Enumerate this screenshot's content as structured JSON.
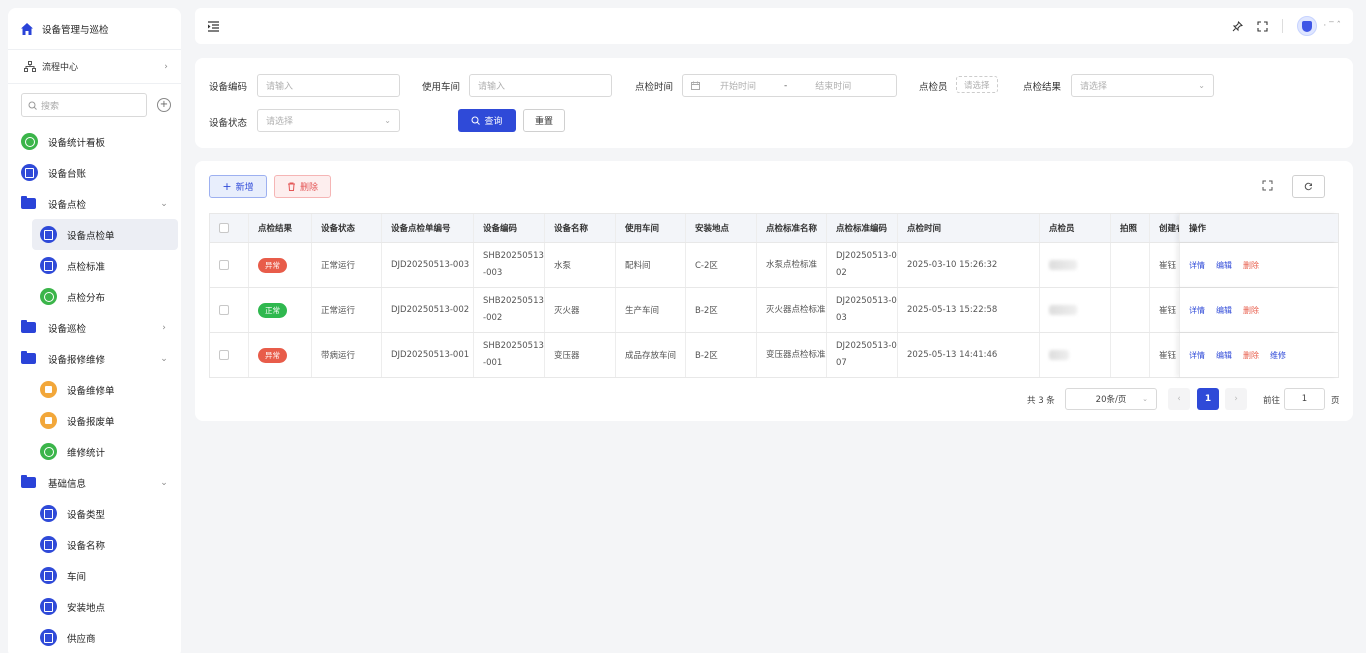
{
  "sidebar": {
    "title": "设备管理与巡检",
    "flow_center": "流程中心",
    "search_placeholder": "搜索",
    "items": [
      {
        "label": "设备统计看板"
      },
      {
        "label": "设备台账"
      },
      {
        "label": "设备点检"
      },
      {
        "label": "设备点检单"
      },
      {
        "label": "点检标准"
      },
      {
        "label": "点检分布"
      },
      {
        "label": "设备巡检"
      },
      {
        "label": "设备报修维修"
      },
      {
        "label": "设备维修单"
      },
      {
        "label": "设备报废单"
      },
      {
        "label": "维修统计"
      },
      {
        "label": "基础信息"
      },
      {
        "label": "设备类型"
      },
      {
        "label": "设备名称"
      },
      {
        "label": "车间"
      },
      {
        "label": "安装地点"
      },
      {
        "label": "供应商"
      }
    ]
  },
  "filters": {
    "device_code_label": "设备编码",
    "device_code_placeholder": "请输入",
    "workshop_label": "使用车间",
    "workshop_placeholder": "请输入",
    "time_label": "点检时间",
    "start_placeholder": "开始时间",
    "range_sep": "-",
    "end_placeholder": "结束时间",
    "inspector_label": "点检员",
    "inspector_placeholder": "请选择",
    "result_label": "点检结果",
    "result_placeholder": "请选择",
    "status_label": "设备状态",
    "status_placeholder": "请选择",
    "query_label": "查询",
    "reset_label": "重置"
  },
  "toolbar": {
    "add_label": "新增",
    "delete_label": "删除"
  },
  "table": {
    "headers": [
      "点检结果",
      "设备状态",
      "设备点检单编号",
      "设备编码",
      "设备名称",
      "使用车间",
      "安装地点",
      "点检标准名称",
      "点检标准编码",
      "点检时间",
      "点检员",
      "拍照",
      "创建者",
      "操作"
    ],
    "rows": [
      {
        "result": "异常",
        "result_color": "#e85c4a",
        "status": "正常运行",
        "no": "DJD20250513-003",
        "code": "SHB20250513-003",
        "name": "水泵",
        "workshop": "配料间",
        "location": "C-2区",
        "std_name": "水泵点检标准",
        "std_code": "DJ20250513-002",
        "time": "2025-03-10 15:26:32",
        "creator": "崔钰",
        "ops": [
          "详情",
          "编辑",
          "删除"
        ]
      },
      {
        "result": "正常",
        "result_color": "#2fb84f",
        "status": "正常运行",
        "no": "DJD20250513-002",
        "code": "SHB20250513-002",
        "name": "灭火器",
        "workshop": "生产车间",
        "location": "B-2区",
        "std_name": "灭火器点检标准",
        "std_code": "DJ20250513-003",
        "time": "2025-05-13 15:22:58",
        "creator": "崔钰",
        "ops": [
          "详情",
          "编辑",
          "删除"
        ]
      },
      {
        "result": "异常",
        "result_color": "#e85c4a",
        "status": "带病运行",
        "no": "DJD20250513-001",
        "code": "SHB20250513-001",
        "name": "变压器",
        "workshop": "成品存放车间",
        "location": "B-2区",
        "std_name": "变压器点检标准",
        "std_code": "DJ20250513-007",
        "time": "2025-05-13 14:41:46",
        "creator": "崔钰",
        "ops": [
          "详情",
          "编辑",
          "删除",
          "维修"
        ]
      }
    ]
  },
  "pagination": {
    "total": "共 3 条",
    "page_size": "20条/页",
    "current": "1",
    "goto_label": "前往",
    "goto_value": "1",
    "goto_suffix": "页"
  },
  "colors": {
    "primary": "#2f4ad8",
    "danger": "#e85c4a",
    "success": "#2fb84f"
  }
}
